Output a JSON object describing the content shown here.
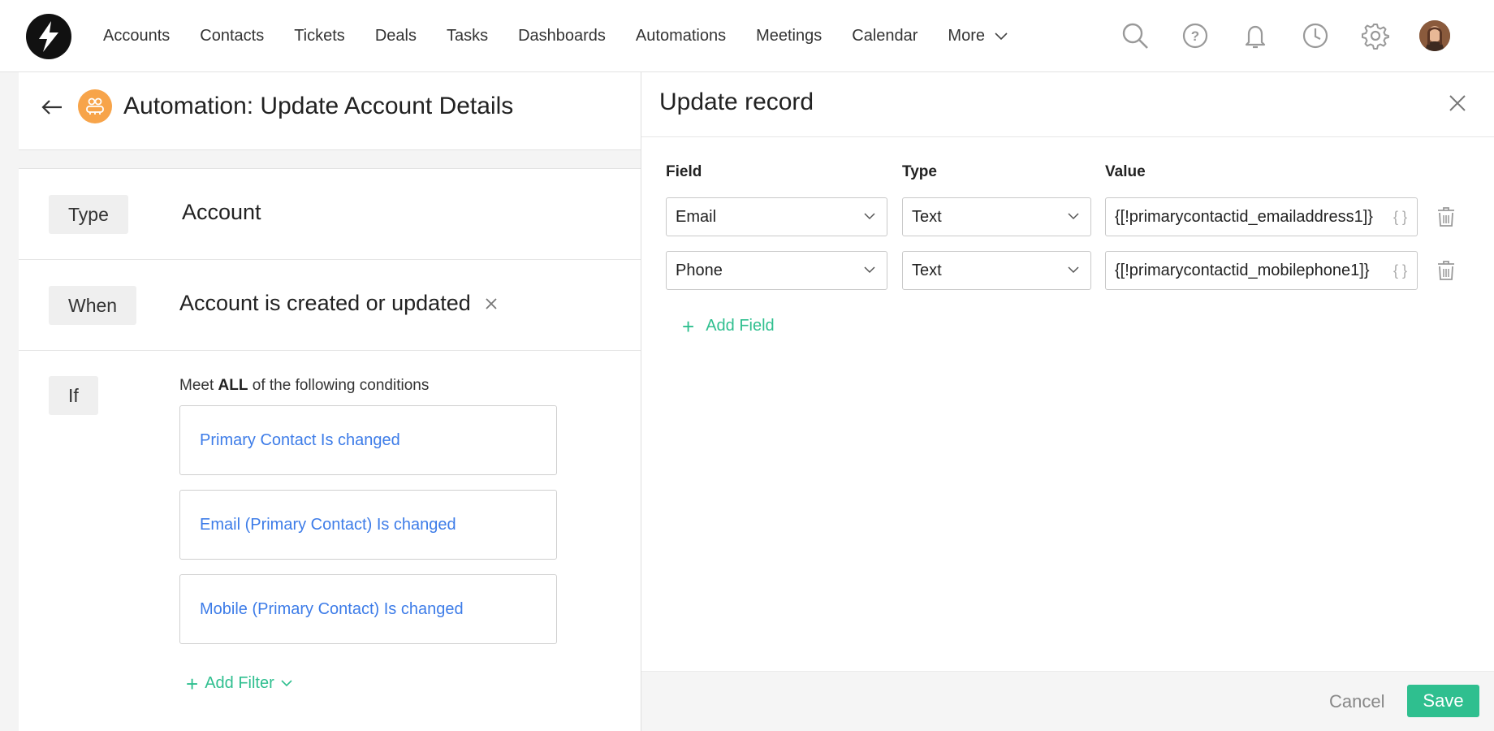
{
  "nav": {
    "links": [
      "Accounts",
      "Contacts",
      "Tickets",
      "Deals",
      "Tasks",
      "Dashboards",
      "Automations",
      "Meetings",
      "Calendar"
    ],
    "more": "More",
    "icons": [
      "search-icon",
      "help-icon",
      "bell-icon",
      "clock-icon",
      "gear-icon"
    ]
  },
  "page": {
    "title": "Automation: Update Account Details"
  },
  "sections": {
    "type": {
      "label": "Type",
      "value": "Account"
    },
    "when": {
      "label": "When",
      "value": "Account is created or updated"
    },
    "if": {
      "label": "If",
      "meet_prefix": "Meet",
      "meet_bold": "ALL",
      "meet_suffix": "of the following conditions",
      "conditions": [
        "Primary Contact Is changed",
        "Email (Primary Contact) Is changed",
        "Mobile (Primary Contact) Is changed"
      ],
      "add_filter": "Add Filter"
    }
  },
  "drawer": {
    "title": "Update record",
    "columns": {
      "field": "Field",
      "type": "Type",
      "value": "Value"
    },
    "rows": [
      {
        "field": "Email",
        "type": "Text",
        "value": "{[!primarycontactid_emailaddress1]}"
      },
      {
        "field": "Phone",
        "type": "Text",
        "value": "{[!primarycontactid_mobilephone1]}"
      }
    ],
    "braces": "{ }",
    "add_field": "Add Field",
    "cancel": "Cancel",
    "save": "Save"
  },
  "colors": {
    "accent_green": "#2fbf8f",
    "link_blue": "#3d7ce8",
    "automation_orange": "#f7a44a"
  }
}
